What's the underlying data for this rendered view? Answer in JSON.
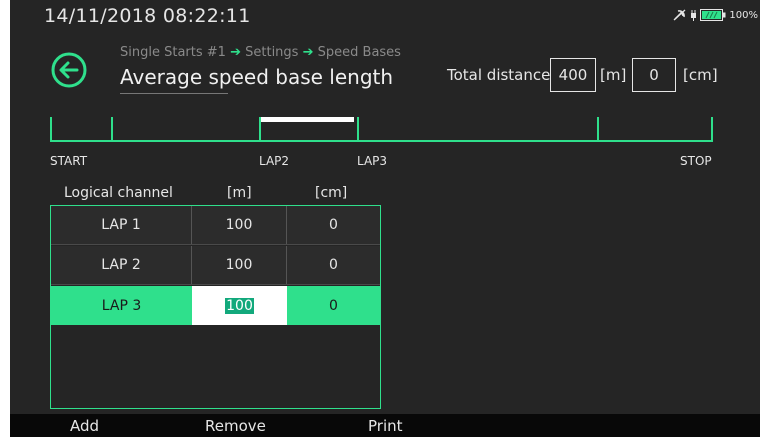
{
  "header": {
    "datetime": "14/11/2018  08:22:11",
    "battery_percent": "100%",
    "icons": [
      "gps-off-icon",
      "plug-icon",
      "battery-icon"
    ]
  },
  "nav": {
    "breadcrumb": [
      "Single Starts #1",
      "Settings",
      "Speed Bases"
    ],
    "title": "Average speed base length"
  },
  "total_distance": {
    "label": "Total distance",
    "meters": "400",
    "meters_unit": "[m]",
    "cm": "0",
    "cm_unit": "[cm]"
  },
  "track": {
    "labels": [
      "START",
      "LAP2",
      "LAP3",
      "STOP"
    ],
    "highlighted_segment": "LAP2-LAP3"
  },
  "table": {
    "headers": [
      "Logical channel",
      "[m]",
      "[cm]"
    ],
    "rows": [
      {
        "channel": "LAP 1",
        "m": "100",
        "cm": "0"
      },
      {
        "channel": "LAP 2",
        "m": "100",
        "cm": "0"
      },
      {
        "channel": "LAP 3",
        "m": "100",
        "cm": "0"
      }
    ],
    "selected_row": 2
  },
  "softkeys": [
    "Add",
    "Remove",
    "Print"
  ],
  "colors": {
    "accent": "#2fe08c",
    "background": "#252525",
    "selection_text_bg": "#12a97c"
  }
}
